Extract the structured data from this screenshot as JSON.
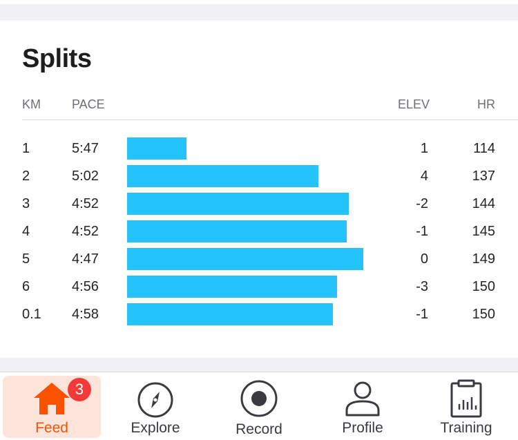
{
  "section_title": "Splits",
  "columns": {
    "km": "KM",
    "pace": "PACE",
    "elev": "ELEV",
    "hr": "HR"
  },
  "bar_color": "#24c3fc",
  "splits": [
    {
      "km": "1",
      "pace": "5:47",
      "elev": "1",
      "hr": "114",
      "relative_speed": 0.25
    },
    {
      "km": "2",
      "pace": "5:02",
      "elev": "4",
      "hr": "137",
      "relative_speed": 0.81
    },
    {
      "km": "3",
      "pace": "4:52",
      "elev": "-2",
      "hr": "144",
      "relative_speed": 0.94
    },
    {
      "km": "4",
      "pace": "4:52",
      "elev": "-1",
      "hr": "145",
      "relative_speed": 0.93
    },
    {
      "km": "5",
      "pace": "4:47",
      "elev": "0",
      "hr": "149",
      "relative_speed": 1.0
    },
    {
      "km": "6",
      "pace": "4:56",
      "elev": "-3",
      "hr": "150",
      "relative_speed": 0.89
    },
    {
      "km": "0.1",
      "pace": "4:58",
      "elev": "-1",
      "hr": "150",
      "relative_speed": 0.87
    }
  ],
  "tabbar": {
    "active_color": "#fc5200",
    "active_bg": "#fde4da",
    "tabs": [
      {
        "label": "Feed",
        "icon": "home-icon",
        "badge": "3",
        "active": true
      },
      {
        "label": "Explore",
        "icon": "compass-icon",
        "active": false
      },
      {
        "label": "Record",
        "icon": "record-icon",
        "active": false
      },
      {
        "label": "Profile",
        "icon": "profile-icon",
        "active": false
      },
      {
        "label": "Training",
        "icon": "training-clipboard-icon",
        "active": false
      }
    ]
  }
}
